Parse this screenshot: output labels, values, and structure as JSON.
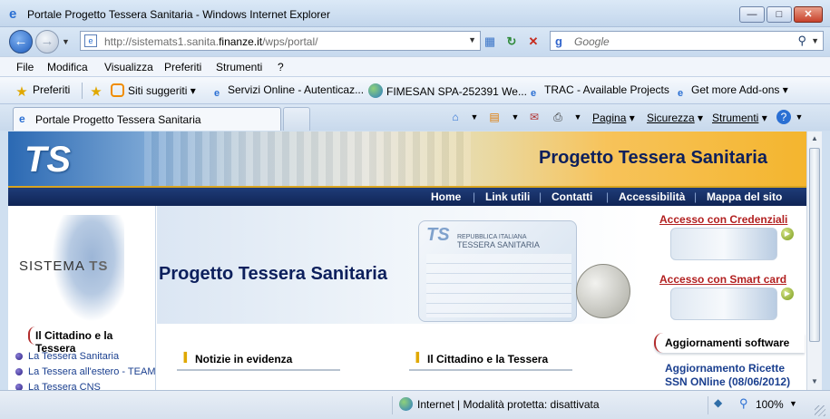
{
  "window": {
    "title": "Portale Progetto Tessera Sanitaria - Windows Internet Explorer",
    "minimize_icon": "minimize-icon",
    "maximize_icon": "maximize-icon",
    "close_icon": "close-icon"
  },
  "address_bar": {
    "url_prefix": "http://sistemats1.sanita.",
    "url_domain": "finanze.it",
    "url_suffix": "/wps/portal/",
    "search_placeholder": "Google"
  },
  "menu": [
    "File",
    "Modifica",
    "Visualizza",
    "Preferiti",
    "Strumenti",
    "?"
  ],
  "favorites_bar": {
    "favorites_label": "Preferiti",
    "items": [
      "Siti suggeriti ▾",
      "Servizi Online - Autenticaz...",
      "FIMESAN SPA-252391 We...",
      "TRAC - Available Projects",
      "Get more Add-ons ▾"
    ]
  },
  "tabs": {
    "active": "Portale Progetto Tessera Sanitaria"
  },
  "command_bar": {
    "page": "Pagina",
    "security": "Sicurezza",
    "tools": "Strumenti",
    "help": "?"
  },
  "page": {
    "header_title": "Progetto Tessera Sanitaria",
    "logo_text": "TS",
    "nav": [
      "Home",
      "Link utili",
      "Contatti",
      "Accessibilità",
      "Mappa del sito"
    ],
    "sistema_label_a": "SISTEMA ",
    "sistema_label_b": "TS",
    "left_section": "Il Cittadino e la Tessera",
    "left_links": [
      "La Tessera Sanitaria",
      "La Tessera all'estero - TEAM",
      "La Tessera CNS"
    ],
    "hero_title": "Progetto Tessera Sanitaria",
    "card_title": "TESSERA SANITARIA",
    "card_top": "REPUBBLICA ITALIANA",
    "center_tabs": [
      "Notizie in evidenza",
      "Il Cittadino e la Tessera"
    ],
    "access_credentials": "Accesso con Credenziali",
    "access_smartcard": "Accesso con Smart card",
    "updates_head": "Aggiornamenti software",
    "update_line1": "Aggiornamento Ricette",
    "update_line2": "SSN ONline (08/06/2012)"
  },
  "status_bar": {
    "zone": "Internet | Modalità protetta: disattivata",
    "zoom": "100%"
  }
}
